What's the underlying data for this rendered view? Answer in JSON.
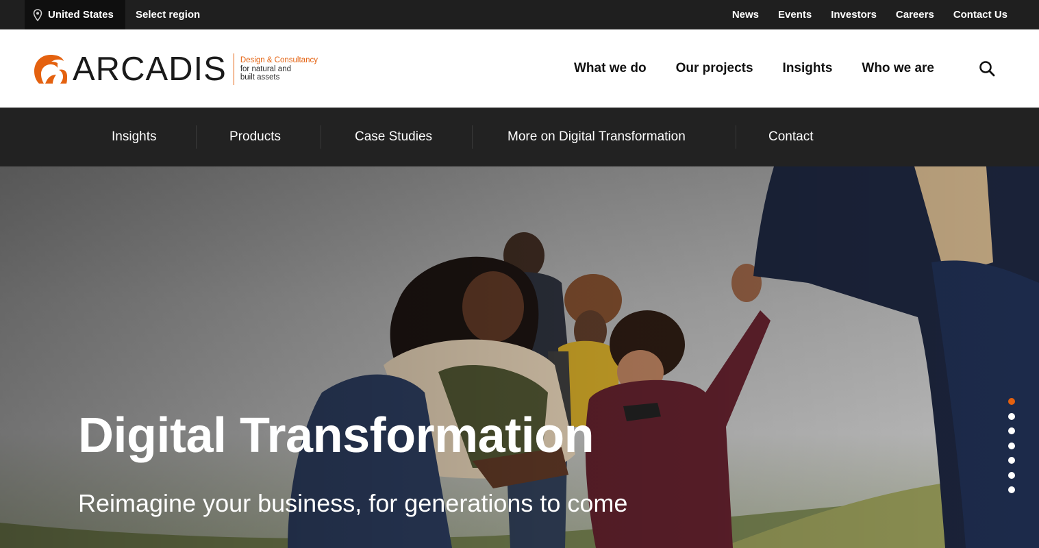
{
  "utility_bar": {
    "region": "United States",
    "select_region": "Select region",
    "links": [
      "News",
      "Events",
      "Investors",
      "Careers",
      "Contact Us"
    ]
  },
  "header": {
    "logo_word": "ARCADIS",
    "tagline": [
      "Design & Consultancy",
      "for natural and",
      "built assets"
    ],
    "nav": [
      "What we do",
      "Our projects",
      "Insights",
      "Who we are"
    ],
    "search_icon": "search-icon"
  },
  "sub_nav": {
    "items": [
      "Insights",
      "Products",
      "Case Studies",
      "More on Digital Transformation",
      "Contact"
    ]
  },
  "hero": {
    "title": "Digital Transformation",
    "subtitle": "Reimagine your business, for generations to come",
    "carousel": {
      "total": 7,
      "active_index": 0
    }
  },
  "colors": {
    "brand_orange": "#e4610f",
    "top_bar": "#1f1f1f",
    "sub_nav": "#222222"
  }
}
